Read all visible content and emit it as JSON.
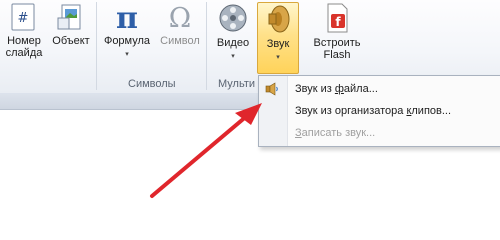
{
  "ribbon": {
    "buttons": [
      {
        "line1": "Номер",
        "line2": "слайда",
        "icon": "slide-number-icon"
      },
      {
        "line1": "Объект",
        "line2": "",
        "icon": "object-icon"
      },
      {
        "line1": "Формула",
        "line2": "",
        "icon": "pi-formula-icon",
        "dropdown": "▾"
      },
      {
        "line1": "Символ",
        "line2": "",
        "icon": "omega-symbol-icon"
      },
      {
        "line1": "Видео",
        "line2": "",
        "icon": "film-reel-icon",
        "dropdown": "▾"
      },
      {
        "line1": "Звук",
        "line2": "",
        "icon": "speaker-icon",
        "dropdown": "▾"
      },
      {
        "line1": "Встроить",
        "line2": "Flash",
        "icon": "flash-icon"
      }
    ],
    "groups": [
      {
        "label": "Символы"
      },
      {
        "label": "Мульти"
      }
    ],
    "colors": {
      "accent_active": "#ffd35a",
      "pi_blue": "#2e5fa8"
    }
  },
  "sound_menu": {
    "items": [
      {
        "label_pre": "Звук из ",
        "label_ul": "ф",
        "label_post": "айла...",
        "icon": "speaker-small-icon",
        "enabled": true
      },
      {
        "label_pre": "Звук из организатора ",
        "label_ul": "к",
        "label_post": "липов...",
        "icon": "",
        "enabled": true
      },
      {
        "label_pre": "",
        "label_ul": "З",
        "label_post": "аписать звук...",
        "icon": "",
        "enabled": false
      }
    ]
  },
  "annotation": {
    "arrow_color": "#e0262c"
  }
}
